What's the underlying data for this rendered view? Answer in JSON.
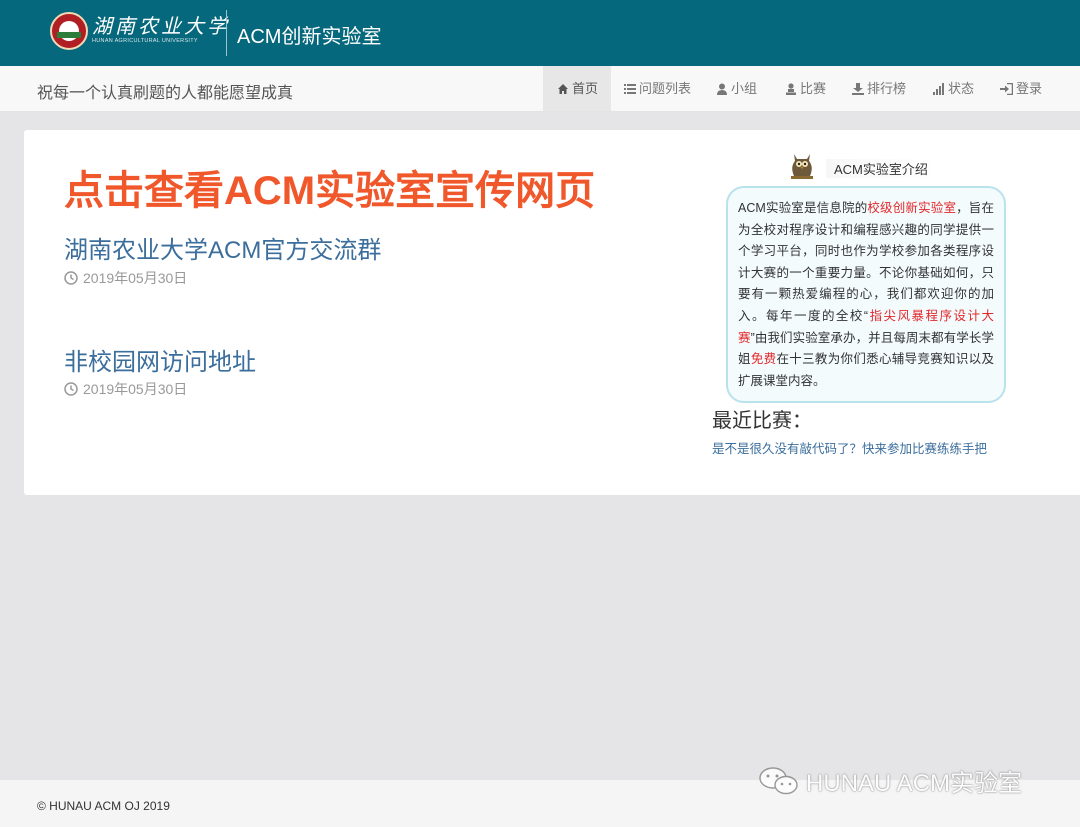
{
  "header": {
    "university_name_cn": "湖南农业大学",
    "university_name_en": "HUNAN AGRICULTURAL UNIVERSITY",
    "app_title": "ACM创新实验室",
    "brand_color": "#06687c"
  },
  "navbar": {
    "motto": "祝每一个认真刷题的人都能愿望成真",
    "items": [
      {
        "label": "首页",
        "icon": "home-icon",
        "active": true
      },
      {
        "label": "问题列表",
        "icon": "list-icon",
        "active": false
      },
      {
        "label": "小组",
        "icon": "user-icon",
        "active": false
      },
      {
        "label": "比赛",
        "icon": "contest-icon",
        "active": false
      },
      {
        "label": "排行榜",
        "icon": "ranklist-icon",
        "active": false
      },
      {
        "label": "状态",
        "icon": "signal-icon",
        "active": false
      },
      {
        "label": "登录",
        "icon": "login-icon",
        "active": false
      }
    ]
  },
  "main": {
    "promo_link": "点击查看ACM实验室宣传网页",
    "posts": [
      {
        "title": "湖南农业大学ACM官方交流群",
        "date": "2019年05月30日"
      },
      {
        "title": "非校园网访问地址",
        "date": "2019年05月30日"
      }
    ]
  },
  "sidebar": {
    "intro_heading": "ACM实验室介绍",
    "intro": {
      "p1": "ACM实验室是信息院的",
      "hl1": "校级创新实验室",
      "p2": "，旨在为全校对程序设计和编程感兴趣的同学提供一个学习平台，同时也作为学校参加各类程序设计大赛的一个重要力量。不论你基础如何，只要有一颗热爱编程的心，我们都欢迎你的加入。每年一度的全校“",
      "hl2": "指尖风暴程序设计大赛",
      "p3": "”由我们实验室承办，并且每周末都有学长学姐",
      "hl3": "免费",
      "p4": "在十三教为你们悉心辅导竞赛知识以及扩展课堂内容。"
    },
    "recent_title": "最近比赛：",
    "recent_link": "是不是很久没有敲代码了？快来参加比赛练练手把"
  },
  "footer": {
    "copyright": "© HUNAU ACM OJ 2019",
    "watermark": "HUNAU ACM实验室",
    "watermark_icon": "wechat-icon"
  },
  "colors": {
    "promo": "#f0582c",
    "link": "#3b6e9c",
    "highlight": "#e3282b"
  }
}
